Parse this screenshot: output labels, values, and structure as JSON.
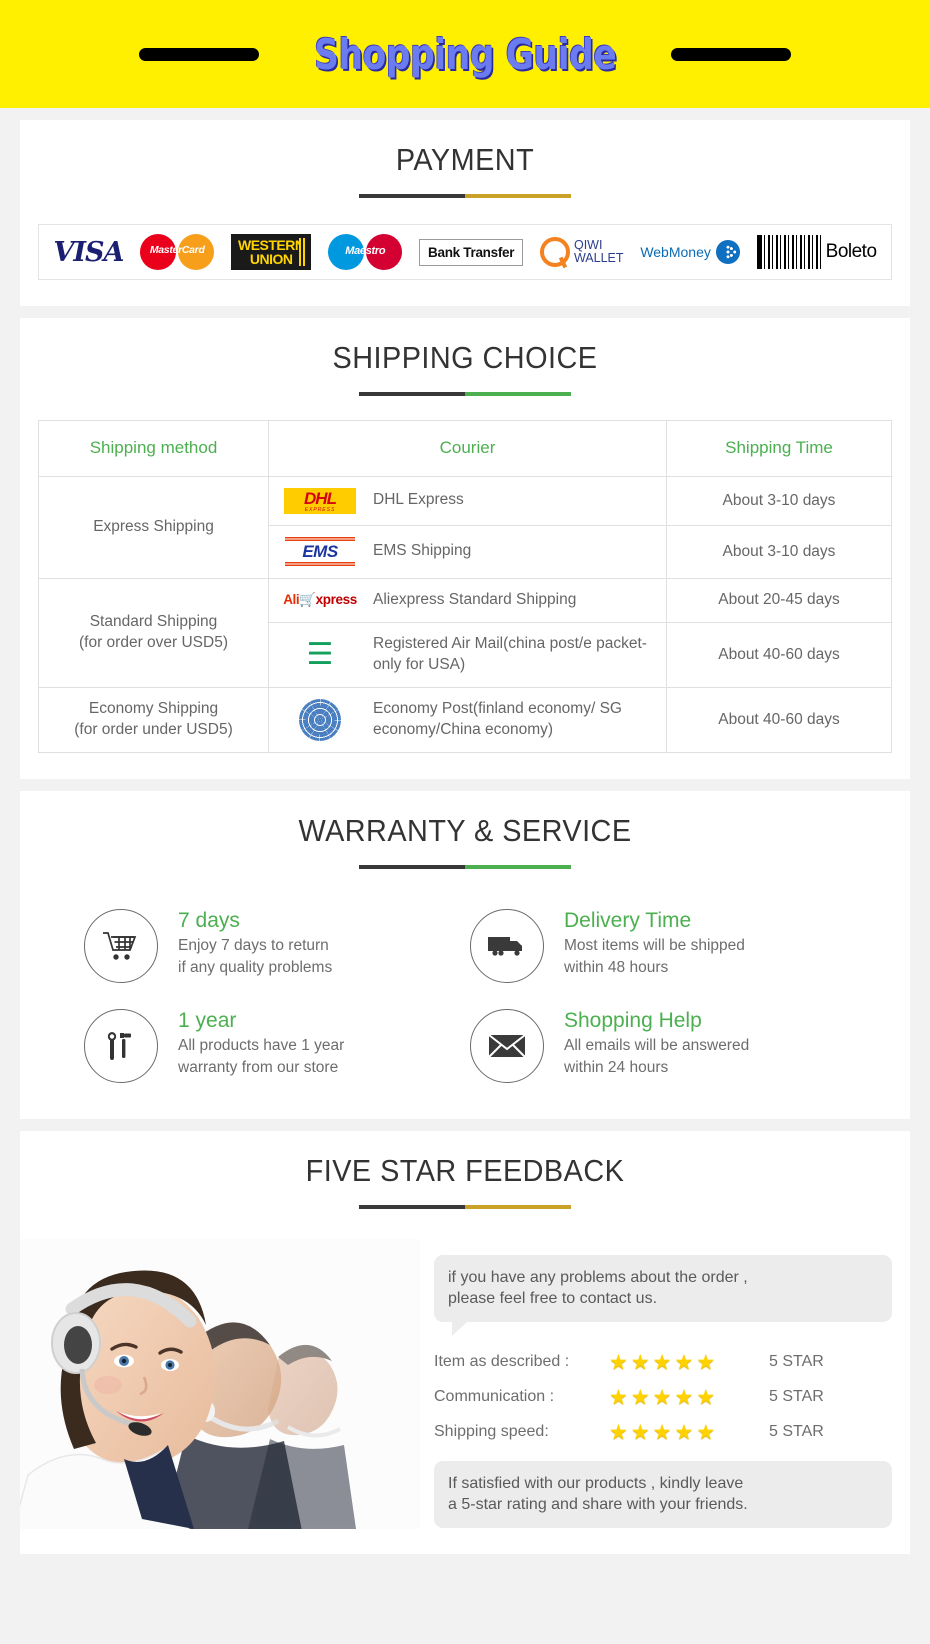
{
  "banner": {
    "title": "Shopping Guide",
    "bg_color": "#fff000",
    "title_color": "#6b7cf0"
  },
  "payment": {
    "heading": "PAYMENT",
    "rule_colors": [
      "#383838",
      "#c9a227"
    ],
    "methods": [
      {
        "name": "VISA",
        "icon": "visa-logo"
      },
      {
        "name": "MasterCard",
        "icon": "mastercard-logo"
      },
      {
        "name": "WESTERN UNION",
        "line1": "WESTERN",
        "line2": "UNION",
        "icon": "western-union-logo"
      },
      {
        "name": "Maestro",
        "icon": "maestro-logo"
      },
      {
        "name": "Bank Transfer",
        "icon": "bank-transfer-logo"
      },
      {
        "name": "QIWI WALLET",
        "line1": "QIWI",
        "line2": "WALLET",
        "icon": "qiwi-wallet-logo"
      },
      {
        "name": "WebMoney",
        "icon": "webmoney-logo"
      },
      {
        "name": "Boleto",
        "icon": "boleto-logo"
      }
    ]
  },
  "shipping": {
    "heading": "SHIPPING CHOICE",
    "rule_colors": [
      "#383838",
      "#4caf50"
    ],
    "columns": [
      "Shipping method",
      "Courier",
      "Shipping Time"
    ],
    "header_color": "#4caf50",
    "rows": [
      {
        "method": "Express Shipping",
        "method_note": "",
        "couriers": [
          {
            "logo": "dhl-logo",
            "logo_text": "DHL",
            "logo_sub": "EXPRESS",
            "name": "DHL Express",
            "time": "About 3-10 days"
          },
          {
            "logo": "ems-logo",
            "logo_text": "EMS",
            "name": "EMS Shipping",
            "time": "About 3-10 days"
          }
        ]
      },
      {
        "method": "Standard Shipping",
        "method_note": "(for order over USD5)",
        "couriers": [
          {
            "logo": "aliexpress-logo",
            "logo_text": "AliExpress",
            "name": "Aliexpress Standard Shipping",
            "time": "About 20-45 days"
          },
          {
            "logo": "china-post-logo",
            "name": "Registered Air Mail(china post/e packet-only for USA)",
            "time": "About 40-60 days"
          }
        ]
      },
      {
        "method": "Economy Shipping",
        "method_note": "(for order under USD5)",
        "couriers": [
          {
            "logo": "un-globe-logo",
            "name": "Economy Post(finland economy/ SG economy/China economy)",
            "time": "About 40-60 days"
          }
        ]
      }
    ]
  },
  "warranty": {
    "heading": "WARRANTY & SERVICE",
    "rule_colors": [
      "#383838",
      "#4caf50"
    ],
    "items": [
      {
        "icon": "shopping-cart-icon",
        "title": "7 days",
        "line1": "Enjoy 7 days to return",
        "line2": "if any quality problems"
      },
      {
        "icon": "truck-icon",
        "title": "Delivery Time",
        "line1": "Most items will be shipped",
        "line2": "within 48 hours"
      },
      {
        "icon": "tools-icon",
        "title": "1 year",
        "line1": "All products have 1 year",
        "line2": "warranty from our store"
      },
      {
        "icon": "envelope-icon",
        "title": "Shopping Help",
        "line1": "All emails will be answered",
        "line2": "within 24 hours"
      }
    ]
  },
  "feedback": {
    "heading": "FIVE STAR FEEDBACK",
    "rule_colors": [
      "#383838",
      "#c9a227"
    ],
    "photo_alt": "customer-service-agents-photo",
    "top_bubble_line1": "if you have any problems about the order ,",
    "top_bubble_line2": "please feel free to contact us.",
    "ratings": [
      {
        "label": "Item as described :",
        "stars": 5,
        "value": "5 STAR"
      },
      {
        "label": "Communication :",
        "stars": 5,
        "value": "5 STAR"
      },
      {
        "label": "Shipping speed:",
        "stars": 5,
        "value": "5 STAR"
      }
    ],
    "bottom_bubble_line1": "If satisfied with our products ,  kindly leave",
    "bottom_bubble_line2": "a 5-star rating and share with your friends."
  }
}
